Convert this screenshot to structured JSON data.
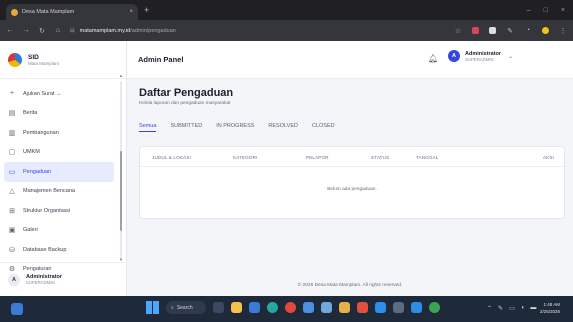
{
  "browser": {
    "tab_title": "Desa Mata Mamplam",
    "tab_close": "×",
    "new_tab": "+",
    "url_host": "matamamplam.my.id",
    "url_path": "/admin/pengaduan",
    "window_buttons": [
      "–",
      "□",
      "×"
    ]
  },
  "sidebar": {
    "brand_title": "SID",
    "brand_subtitle": "Mata Mamplam",
    "items": [
      {
        "label": "Ajukan Surat →",
        "icon": "plus-icon",
        "glyph": "+"
      },
      {
        "label": "Berita",
        "icon": "news-icon",
        "glyph": "▤"
      },
      {
        "label": "Pembangunan",
        "icon": "building-icon",
        "glyph": "▥"
      },
      {
        "label": "UMKM",
        "icon": "bag-icon",
        "glyph": "▢"
      },
      {
        "label": "Pengaduan",
        "icon": "chat-icon",
        "glyph": "▭"
      },
      {
        "label": "Manajemen Bencana",
        "icon": "warning-icon",
        "glyph": "△"
      },
      {
        "label": "Struktur Organisasi",
        "icon": "org-icon",
        "glyph": "⊞"
      },
      {
        "label": "Galeri",
        "icon": "image-icon",
        "glyph": "▣"
      },
      {
        "label": "Database Backup",
        "icon": "database-icon",
        "glyph": "⛁"
      },
      {
        "label": "Pengaturan",
        "icon": "gear-icon",
        "glyph": "⚙"
      }
    ],
    "active_index": 4,
    "user_initial": "A",
    "user_name": "Administrator",
    "user_role": "SUPERADMIN"
  },
  "topbar": {
    "title": "Admin Panel",
    "admin_initial": "A",
    "admin_name": "Administrator",
    "admin_role": "SUPERADMIN"
  },
  "page": {
    "title": "Daftar Pengaduan",
    "subtitle": "Kelola laporan dan pengaduan masyarakat",
    "tabs": [
      "Semua",
      "SUBMITTED",
      "IN PROGRESS",
      "RESOLVED",
      "CLOSED"
    ],
    "active_tab": 0,
    "columns": [
      "JUDUL & LOKASI",
      "KATEGORI",
      "PELAPOR",
      "STATUS",
      "TANGGAL",
      "AKSI"
    ],
    "empty_message": "Belum ada pengaduan."
  },
  "footer": "© 2026 Desa Mata Mamplam. All rights reserved.",
  "taskbar": {
    "search_label": "Search",
    "time": "1:48 AM",
    "date": "2/25/2026"
  },
  "colors": {
    "accent": "#3547d8",
    "active_bg": "#e7ebff"
  }
}
